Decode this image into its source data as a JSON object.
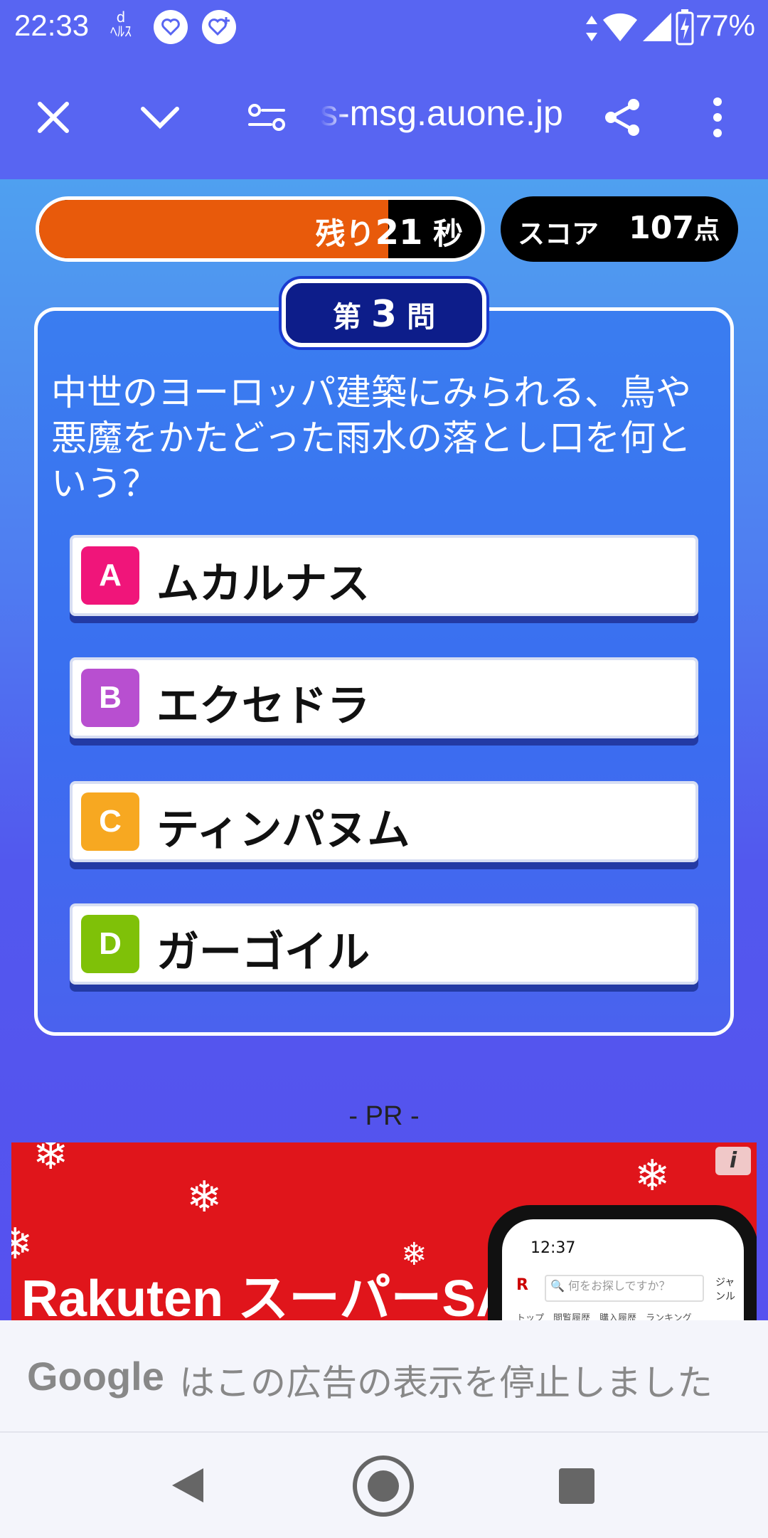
{
  "status_bar": {
    "time": "22:33",
    "battery": "77%",
    "icons": [
      "d-healthcare-icon",
      "heart-app-icon",
      "heart-plus-app-icon",
      "data-arrows-icon",
      "wifi-icon",
      "signal-icon",
      "battery-charging-icon"
    ]
  },
  "browser": {
    "url": "s-msg.auone.jp",
    "icons": [
      "close-icon",
      "chevron-down-icon",
      "site-settings-icon",
      "share-icon",
      "more-icon"
    ]
  },
  "timer": {
    "label": "残り",
    "value": "21",
    "unit": "秒",
    "remaining_fraction": 0.79,
    "fill_color": "#e85a0b"
  },
  "score": {
    "label": "スコア",
    "value": "107",
    "unit": "点"
  },
  "question_number": {
    "prefix": "第",
    "number": "3",
    "suffix": "問"
  },
  "question": "中世のヨーロッパ建築にみられる、鳥や悪魔をかたどった雨水の落とし口を何という？",
  "choices": [
    {
      "letter": "A",
      "text": "ムカルナス",
      "color": "#f0157a"
    },
    {
      "letter": "B",
      "text": "エクセドラ",
      "color": "#b84fd0"
    },
    {
      "letter": "C",
      "text": "ティンパヌム",
      "color": "#f7a821"
    },
    {
      "letter": "D",
      "text": "ガーゴイル",
      "color": "#7fc108"
    }
  ],
  "pr_label": "- PR -",
  "ad": {
    "brand": "Rakuten スーパーSALE",
    "info": "i",
    "phone_time": "12:37",
    "phone_search_placeholder": "何をお探しですか？",
    "phone_menu": "ジャンル",
    "phone_tabs": "トップ　閲覧履歴　購入履歴　ランキング"
  },
  "google_notice": {
    "logo": "Google",
    "message": "はこの広告の表示を停止しました"
  },
  "nav": {
    "icons": [
      "back-icon",
      "home-icon",
      "recents-icon"
    ]
  }
}
